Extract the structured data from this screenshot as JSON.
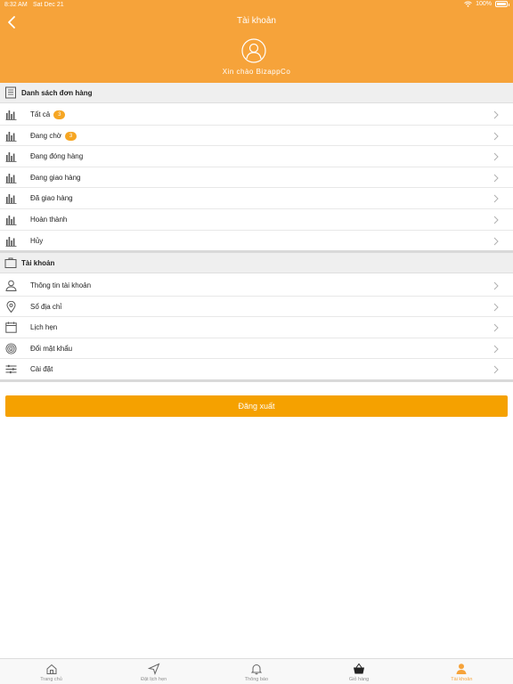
{
  "status_bar": {
    "time": "8:32 AM",
    "date": "Sat Dec 21",
    "battery": "100%"
  },
  "header": {
    "title": "Tài khoản",
    "greeting": "Xin chào BizappCo"
  },
  "orders": {
    "title": "Danh sách đơn hàng",
    "items": [
      {
        "label": "Tất cả",
        "badge": "3"
      },
      {
        "label": "Đang chờ",
        "badge": "3"
      },
      {
        "label": "Đang đóng hàng"
      },
      {
        "label": "Đang giao hàng"
      },
      {
        "label": "Đã giao hàng"
      },
      {
        "label": "Hoàn thành"
      },
      {
        "label": "Hủy"
      }
    ]
  },
  "account": {
    "title": "Tài khoản",
    "items": [
      {
        "label": "Thông tin tài khoản",
        "icon": "person-icon"
      },
      {
        "label": "Sổ địa chỉ",
        "icon": "location-pin-icon"
      },
      {
        "label": "Lịch hẹn",
        "icon": "calendar-icon"
      },
      {
        "label": "Đổi mật khẩu",
        "icon": "fingerprint-icon"
      },
      {
        "label": "Cài đặt",
        "icon": "sliders-icon"
      }
    ]
  },
  "logout_label": "Đăng xuất",
  "tabs": [
    {
      "label": "Trang chủ",
      "icon": "home-icon"
    },
    {
      "label": "Đặt lịch hẹn",
      "icon": "send-icon"
    },
    {
      "label": "Thông báo",
      "icon": "bell-icon"
    },
    {
      "label": "Giỏ hàng",
      "icon": "basket-icon"
    },
    {
      "label": "Tài khoản",
      "icon": "user-icon",
      "active": true
    }
  ],
  "colors": {
    "accent": "#f6a33a",
    "button": "#f5a100",
    "badge": "#f6a623"
  }
}
